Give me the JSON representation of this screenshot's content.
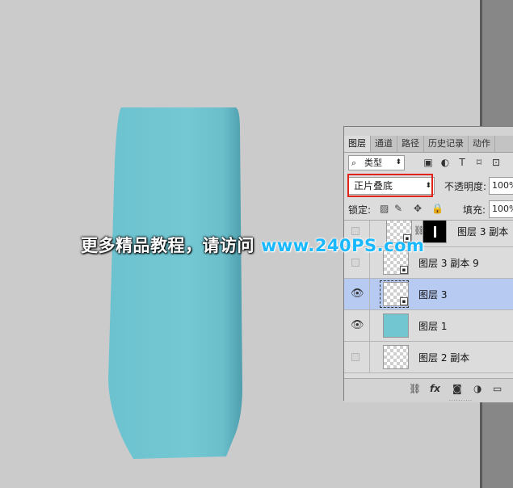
{
  "colors": {
    "vase": "#72c6d2",
    "canvas_bg": "#cbcbcb",
    "selected_row": "#b7cbf2",
    "highlight": "#e2231a",
    "watermark_url": "#19b8ff"
  },
  "panel": {
    "tabs": [
      "图层",
      "通道",
      "路径",
      "历史记录",
      "动作"
    ],
    "filter": {
      "label": "类型",
      "icon": "search-icon"
    },
    "filter_icons": [
      "image-filter-icon",
      "adjustment-filter-icon",
      "text-filter-icon",
      "shape-filter-icon",
      "smart-object-filter-icon"
    ],
    "blend_mode": "正片叠底",
    "opacity_label": "不透明度:",
    "opacity_value": "100%",
    "lock_label": "锁定:",
    "fill_label": "填充:",
    "fill_value": "100%",
    "layers": [
      {
        "name": "图层 3 副本",
        "visible": false,
        "selected": false,
        "has_mask": true,
        "thumb": "transparent"
      },
      {
        "name": "图层 3 副本 9",
        "visible": false,
        "selected": false,
        "has_mask": false,
        "thumb": "transparent"
      },
      {
        "name": "图层 3",
        "visible": true,
        "selected": true,
        "has_mask": false,
        "thumb": "transparent"
      },
      {
        "name": "图层 1",
        "visible": true,
        "selected": false,
        "has_mask": false,
        "thumb": "solid"
      },
      {
        "name": "图层 2 副本",
        "visible": false,
        "selected": false,
        "has_mask": false,
        "thumb": "transparent"
      }
    ],
    "bottom_icons": [
      "link-icon",
      "fx-icon",
      "mask-icon",
      "adjustment-icon",
      "folder-icon"
    ],
    "fx_label": "fx"
  },
  "watermark": {
    "text": "更多精品教程，请访问",
    "url": "www.240PS.com"
  }
}
